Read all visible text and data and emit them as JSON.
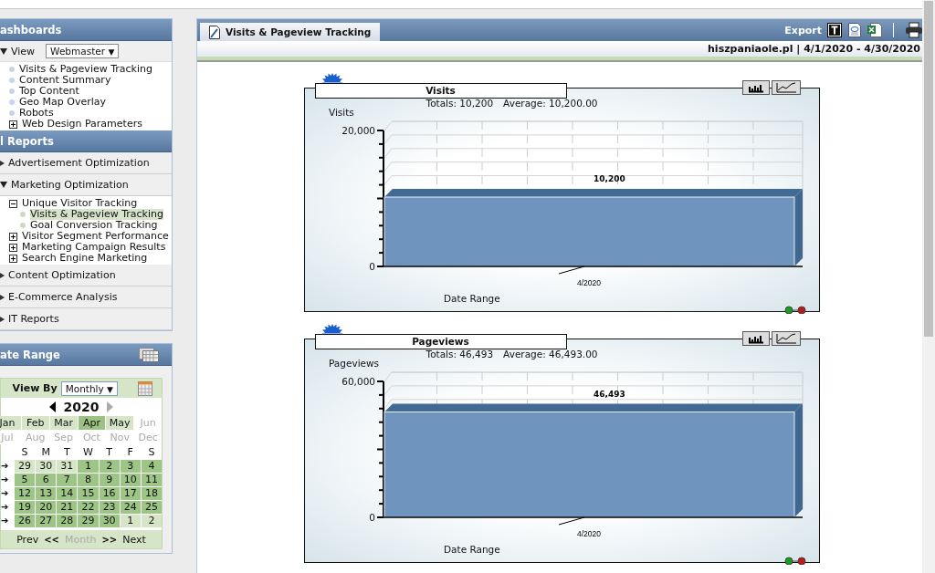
{
  "sidebar": {
    "dashboards": {
      "title": "ashboards",
      "view_label": "View",
      "view_select": "Webmaster",
      "view_select_caret": "▼",
      "items": [
        {
          "label": "Visits & Pageview Tracking",
          "kind": "leaf"
        },
        {
          "label": "Content Summary",
          "kind": "leaf"
        },
        {
          "label": "Top Content",
          "kind": "leaf"
        },
        {
          "label": "Geo Map Overlay",
          "kind": "leaf"
        },
        {
          "label": "Robots",
          "kind": "leaf"
        },
        {
          "label": "Web Design Parameters",
          "kind": "folder",
          "expanded": false
        }
      ]
    },
    "reports": {
      "title": "l Reports",
      "sections": [
        {
          "label": "Advertisement Optimization",
          "expanded": false
        },
        {
          "label": "Marketing Optimization",
          "expanded": true,
          "children": [
            {
              "label": "Unique Visitor Tracking",
              "kind": "folder",
              "expanded": true,
              "children": [
                {
                  "label": "Visits & Pageview Tracking",
                  "kind": "leaf",
                  "selected": true
                },
                {
                  "label": "Goal Conversion Tracking",
                  "kind": "leaf",
                  "selected": false
                }
              ]
            },
            {
              "label": "Visitor Segment Performance",
              "kind": "folder",
              "expanded": false
            },
            {
              "label": "Marketing Campaign Results",
              "kind": "folder",
              "expanded": false
            },
            {
              "label": "Search Engine Marketing",
              "kind": "folder",
              "expanded": false
            }
          ]
        },
        {
          "label": "Content Optimization",
          "expanded": false
        },
        {
          "label": "E-Commerce Analysis",
          "expanded": false
        },
        {
          "label": "IT Reports",
          "expanded": false
        }
      ]
    },
    "date_range": {
      "title": "ate Range",
      "view_by_label": "View By",
      "view_by_select": "Monthly",
      "view_by_caret": "▼",
      "year": "2020",
      "next_year_disabled": true,
      "months": [
        {
          "label": "Jan",
          "selected": false,
          "disabled": false
        },
        {
          "label": "Feb",
          "selected": false,
          "disabled": false
        },
        {
          "label": "Mar",
          "selected": false,
          "disabled": false
        },
        {
          "label": "Apr",
          "selected": true,
          "disabled": false
        },
        {
          "label": "May",
          "selected": false,
          "disabled": false
        },
        {
          "label": "Jun",
          "selected": false,
          "disabled": true
        },
        {
          "label": "Jul",
          "selected": false,
          "disabled": true
        },
        {
          "label": "Aug",
          "selected": false,
          "disabled": true
        },
        {
          "label": "Sep",
          "selected": false,
          "disabled": true
        },
        {
          "label": "Oct",
          "selected": false,
          "disabled": true
        },
        {
          "label": "Nov",
          "selected": false,
          "disabled": true
        },
        {
          "label": "Dec",
          "selected": false,
          "disabled": true
        }
      ],
      "weekdays": [
        "S",
        "M",
        "T",
        "W",
        "T",
        "F",
        "S"
      ],
      "weeks": [
        {
          "arrow": "➔",
          "days": [
            {
              "label": "29",
              "in_month": false
            },
            {
              "label": "30",
              "in_month": false
            },
            {
              "label": "31",
              "in_month": false
            },
            {
              "label": "1",
              "in_month": true
            },
            {
              "label": "2",
              "in_month": true
            },
            {
              "label": "3",
              "in_month": true
            },
            {
              "label": "4",
              "in_month": true
            }
          ]
        },
        {
          "arrow": "➔",
          "days": [
            {
              "label": "5",
              "in_month": true
            },
            {
              "label": "6",
              "in_month": true
            },
            {
              "label": "7",
              "in_month": true
            },
            {
              "label": "8",
              "in_month": true
            },
            {
              "label": "9",
              "in_month": true
            },
            {
              "label": "10",
              "in_month": true
            },
            {
              "label": "11",
              "in_month": true
            }
          ]
        },
        {
          "arrow": "➔",
          "days": [
            {
              "label": "12",
              "in_month": true
            },
            {
              "label": "13",
              "in_month": true
            },
            {
              "label": "14",
              "in_month": true
            },
            {
              "label": "15",
              "in_month": true
            },
            {
              "label": "16",
              "in_month": true
            },
            {
              "label": "17",
              "in_month": true
            },
            {
              "label": "18",
              "in_month": true
            }
          ]
        },
        {
          "arrow": "➔",
          "days": [
            {
              "label": "19",
              "in_month": true
            },
            {
              "label": "20",
              "in_month": true
            },
            {
              "label": "21",
              "in_month": true
            },
            {
              "label": "22",
              "in_month": true
            },
            {
              "label": "23",
              "in_month": true
            },
            {
              "label": "24",
              "in_month": true
            },
            {
              "label": "25",
              "in_month": true
            }
          ]
        },
        {
          "arrow": "➔",
          "days": [
            {
              "label": "26",
              "in_month": true
            },
            {
              "label": "27",
              "in_month": true
            },
            {
              "label": "28",
              "in_month": true
            },
            {
              "label": "29",
              "in_month": true
            },
            {
              "label": "30",
              "in_month": true
            },
            {
              "label": "1",
              "in_month": false
            },
            {
              "label": "2",
              "in_month": false
            }
          ]
        }
      ],
      "footer": {
        "prev": "Prev",
        "prev_arrow": "<<",
        "month": "Month",
        "month_disabled": true,
        "next_arrow": ">>",
        "next": "Next"
      }
    }
  },
  "main": {
    "tab": "Visits & Pageview Tracking",
    "export_label": "Export",
    "site_line": "hiszpaniaole.pl | 4/1/2020 - 4/30/2020",
    "charts": [
      {
        "totals": "Totals: 10,200",
        "average": "Average: 10,200.00",
        "chart_data": {
          "type": "bar",
          "title": "Visits",
          "ylabel": "Visits",
          "xlabel": "Date Range",
          "categories": [
            "4/2020"
          ],
          "values": [
            10200
          ],
          "ylim": [
            0,
            20000
          ],
          "yticks": [
            {
              "value": 0,
              "label": "0"
            },
            {
              "value": 20000,
              "label": "20,000"
            }
          ],
          "value_labels": [
            "10,200"
          ]
        }
      },
      {
        "totals": "Totals: 46,493",
        "average": "Average: 46,493.00",
        "chart_data": {
          "type": "bar",
          "title": "Pageviews",
          "ylabel": "Pageviews",
          "xlabel": "Date Range",
          "categories": [
            "4/2020"
          ],
          "values": [
            46493
          ],
          "ylim": [
            0,
            60000
          ],
          "yticks": [
            {
              "value": 0,
              "label": "0"
            },
            {
              "value": 60000,
              "label": "60,000"
            }
          ],
          "value_labels": [
            "46,493"
          ]
        }
      }
    ]
  }
}
